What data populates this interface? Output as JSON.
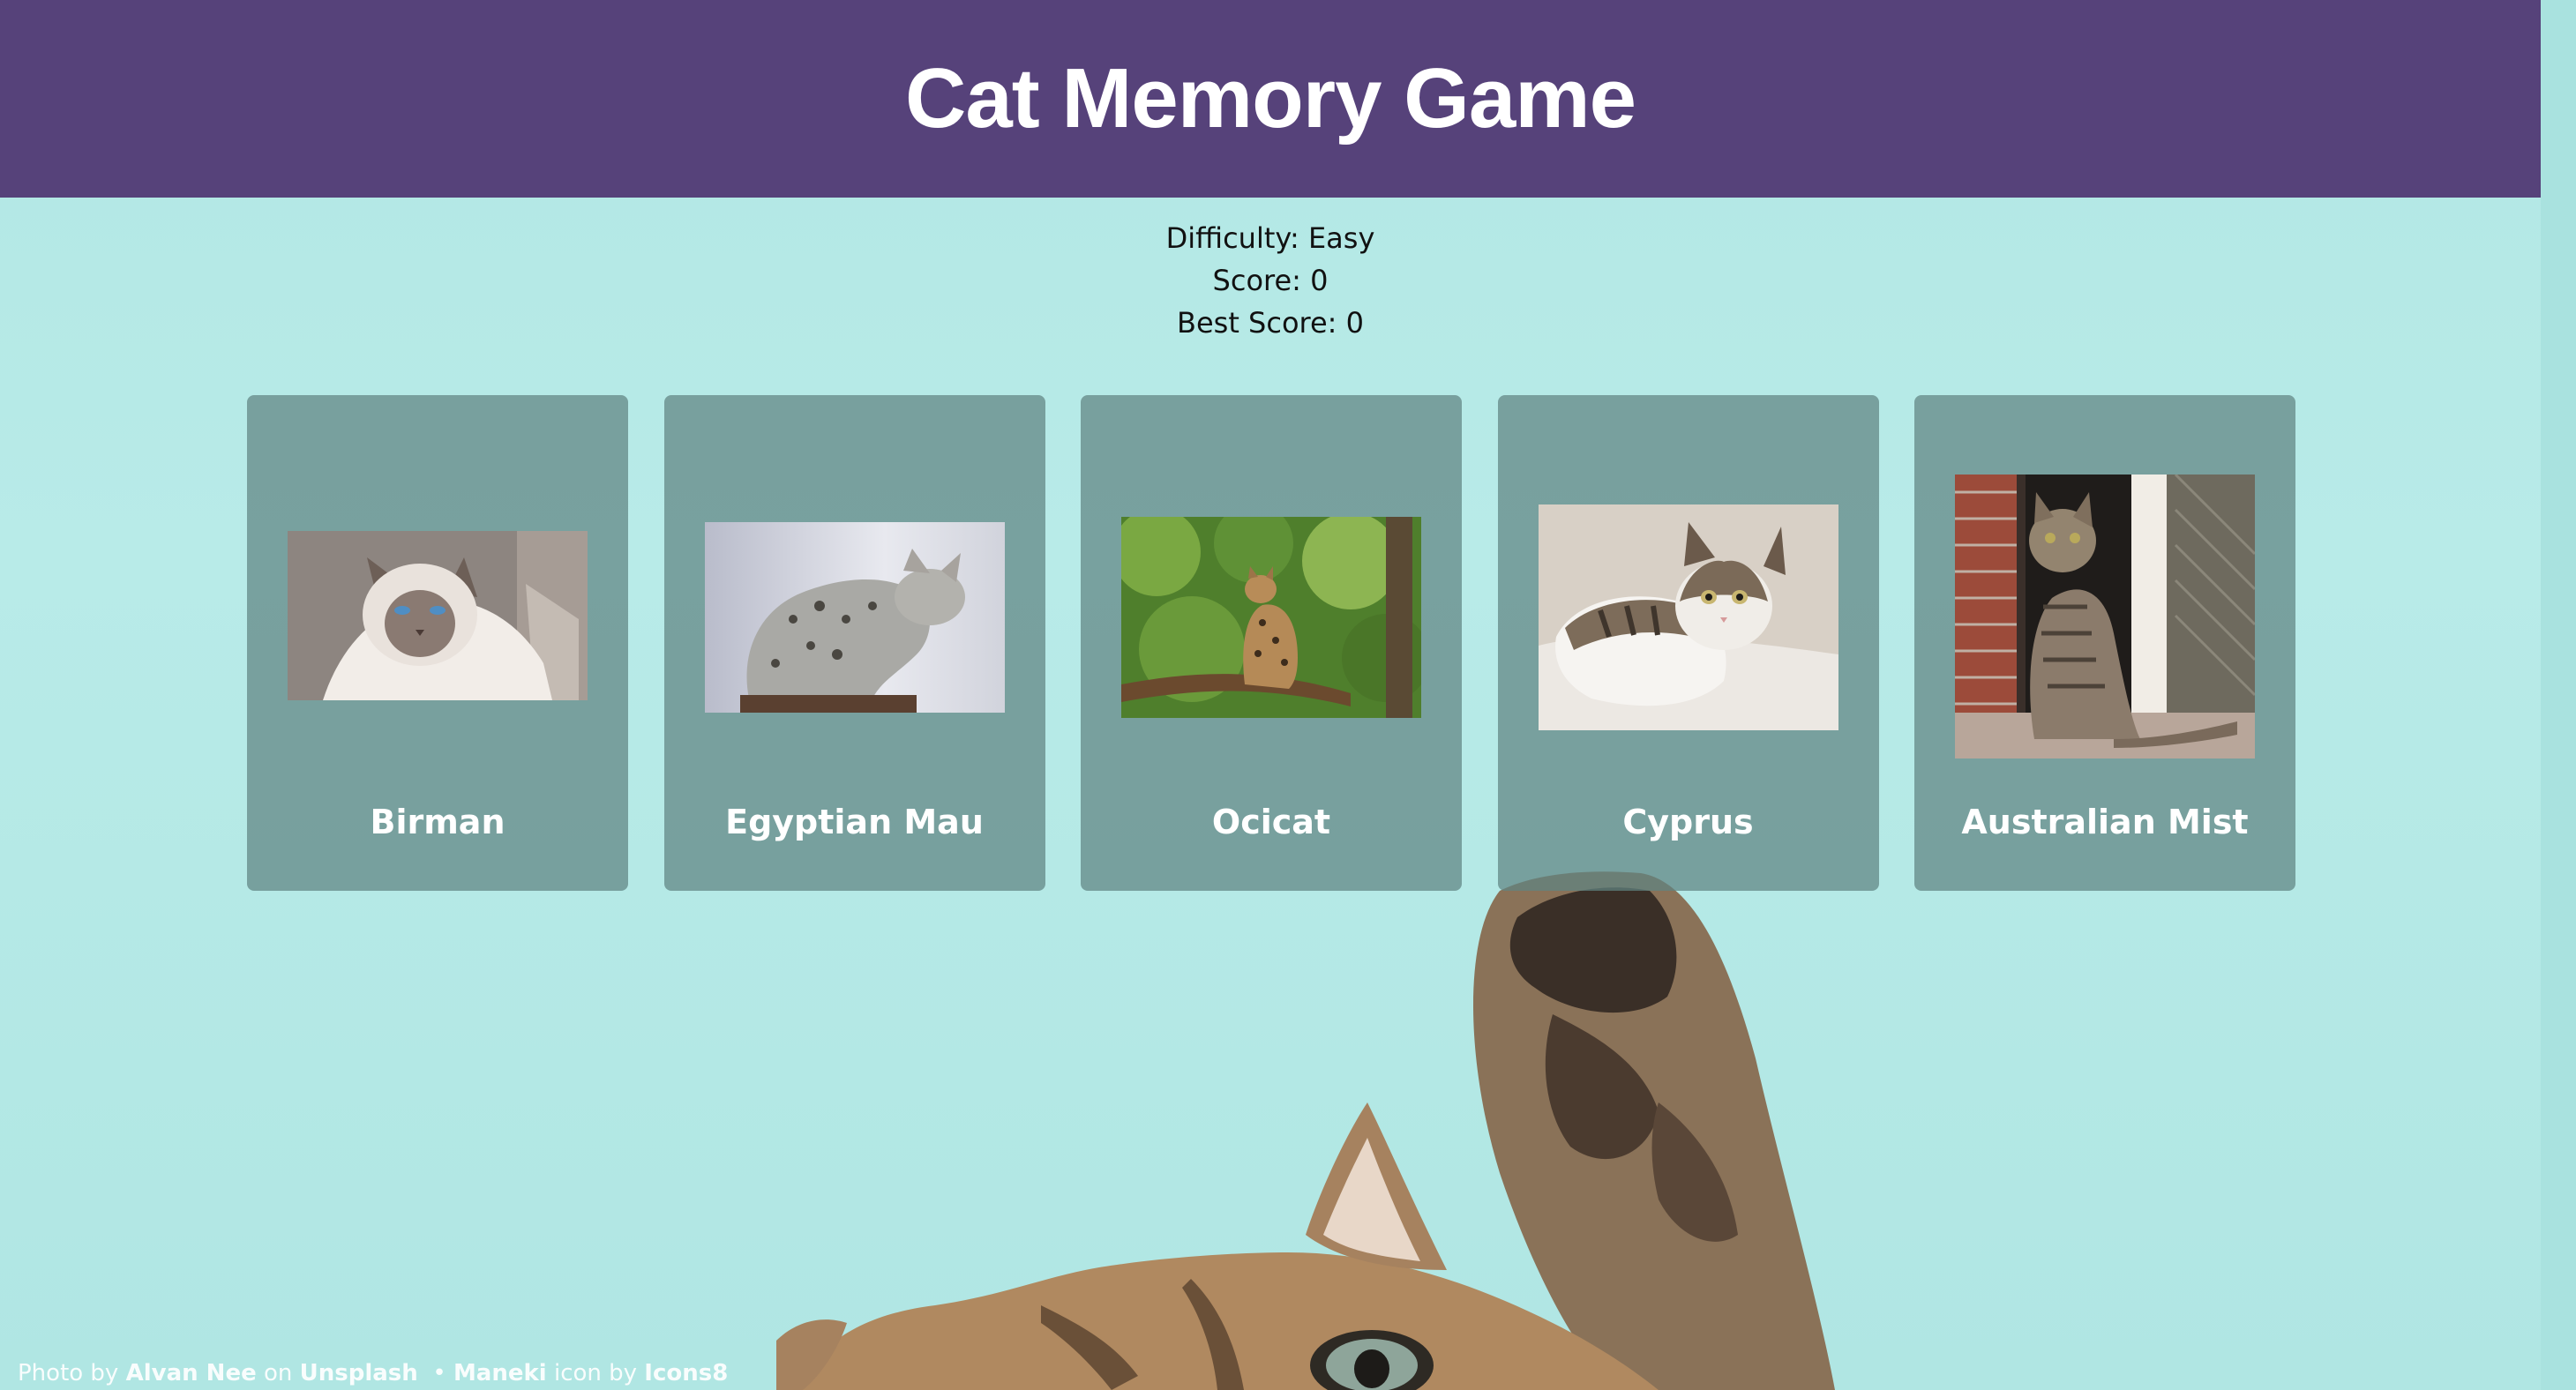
{
  "header": {
    "title": "Cat Memory Game"
  },
  "stats": {
    "difficulty_label": "Difficulty: Easy",
    "score_label": "Score: 0",
    "best_score_label": "Best Score: 0"
  },
  "cards": [
    {
      "name": "Birman"
    },
    {
      "name": "Egyptian Mau"
    },
    {
      "name": "Ocicat"
    },
    {
      "name": "Cyprus"
    },
    {
      "name": "Australian Mist"
    }
  ],
  "footer": {
    "photo_by": "Photo by",
    "photographer": "Alvan Nee",
    "on": "on",
    "site": "Unsplash",
    "separator": "•",
    "icon_name": "Maneki",
    "icon_by": "icon by",
    "icon_source": "Icons8"
  },
  "colors": {
    "header_bg": "#56427a",
    "page_bg": "#b2e7e4",
    "card_bg": "#7fa3a1"
  }
}
